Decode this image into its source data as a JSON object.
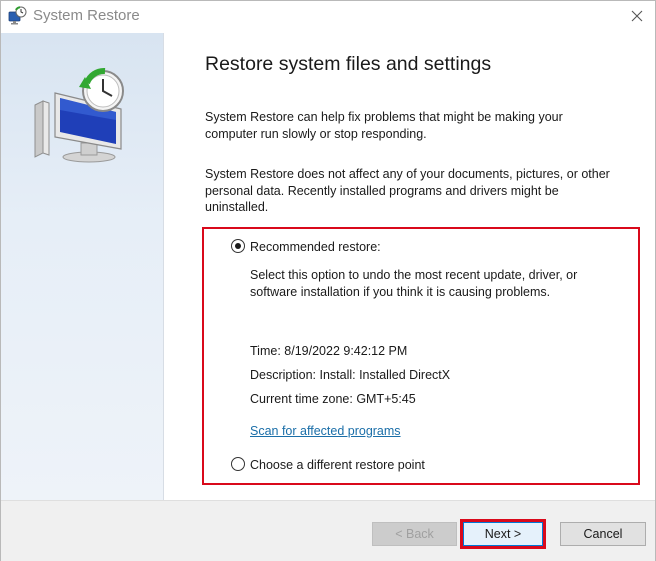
{
  "window": {
    "title": "System Restore",
    "close_symbol": "✕"
  },
  "main": {
    "heading": "Restore system files and settings",
    "para1": "System Restore can help fix problems that might be making your computer run slowly or stop responding.",
    "para2": "System Restore does not affect any of your documents, pictures, or other personal data. Recently installed programs and drivers might be uninstalled."
  },
  "options": {
    "recommended": {
      "label": "Recommended restore:",
      "selected": true,
      "description": "Select this option to undo the most recent update, driver, or software installation if you think it is causing problems.",
      "time_label": "Time:",
      "time_value": "8/19/2022 9:42:12 PM",
      "desc_label": "Description:",
      "desc_value": "Install: Installed DirectX",
      "tz_label": "Current time zone:",
      "tz_value": "GMT+5:45",
      "scan_link": "Scan for affected programs"
    },
    "different": {
      "label": "Choose a different restore point",
      "selected": false
    }
  },
  "footer": {
    "back_label": "< Back",
    "next_label": "Next >",
    "cancel_label": "Cancel"
  },
  "colors": {
    "highlight": "#d9091b",
    "link": "#1a6ea8",
    "sidebar": "#dde7f2"
  },
  "icons": {
    "app": "system-restore-icon",
    "close": "close-icon",
    "sidebar": "monitor-clock-restore-icon"
  }
}
